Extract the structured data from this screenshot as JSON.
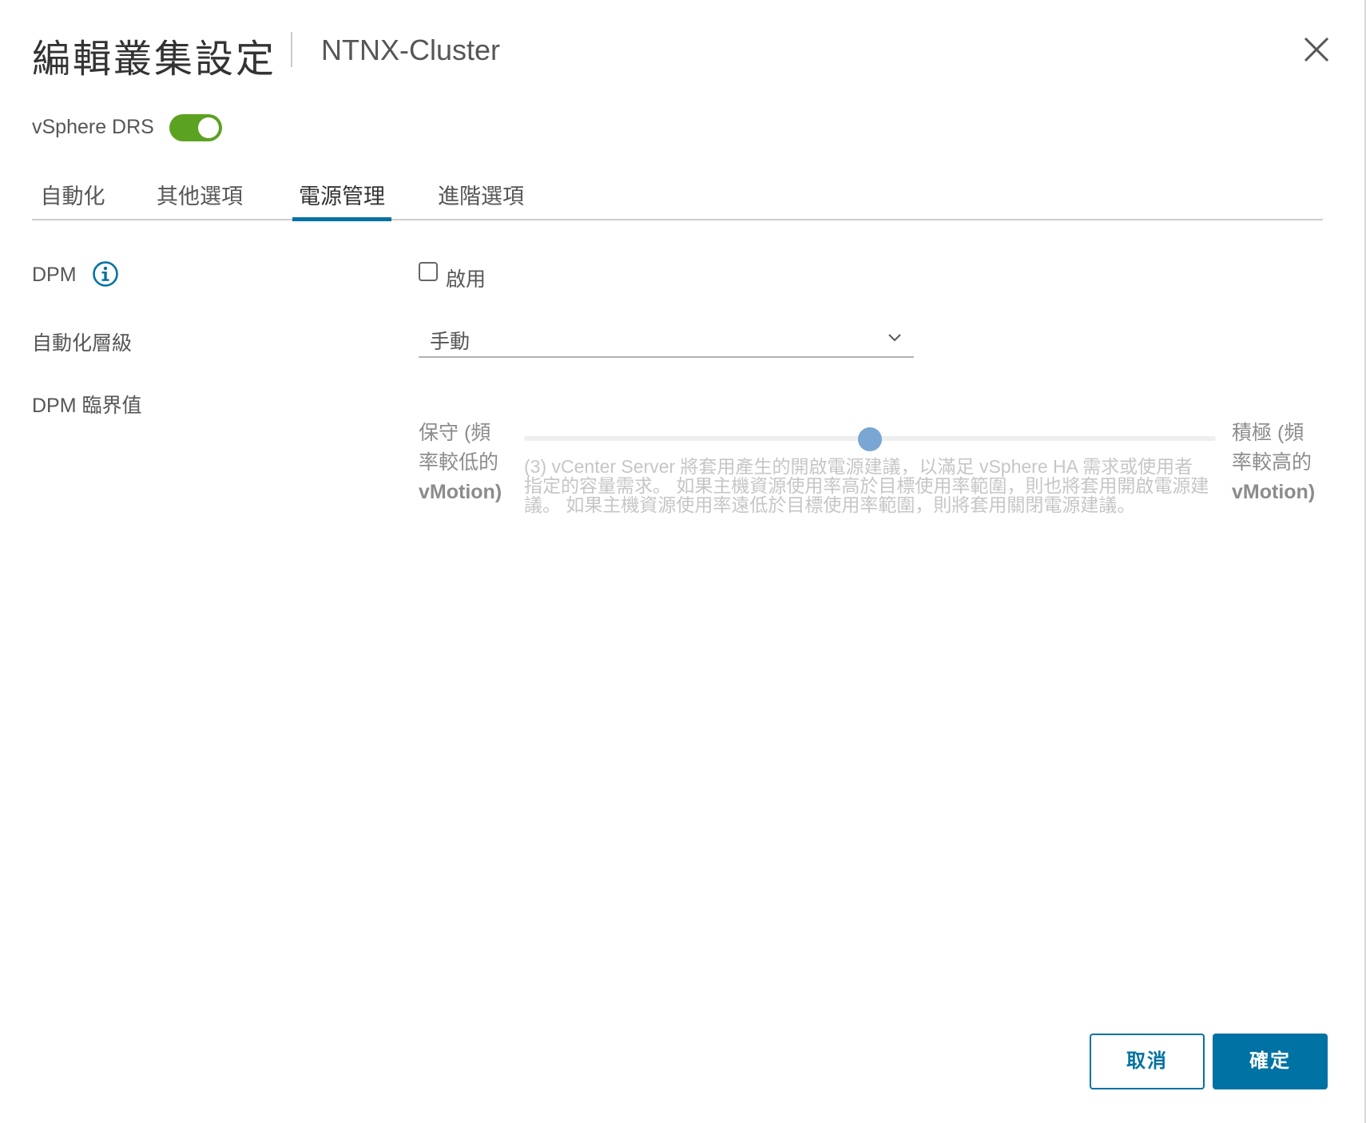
{
  "dialog": {
    "title": "編輯叢集設定",
    "subtitle": "NTNX-Cluster",
    "close_icon": "close-icon"
  },
  "drs": {
    "label": "vSphere DRS",
    "enabled": true,
    "toggle_color": "#5aa220"
  },
  "tabs": [
    {
      "label": "自動化",
      "active": false
    },
    {
      "label": "其他選項",
      "active": false
    },
    {
      "label": "電源管理",
      "active": true
    },
    {
      "label": "進階選項",
      "active": false
    }
  ],
  "form": {
    "dpm": {
      "label": "DPM",
      "info_icon": "info-icon",
      "checkbox_label": "啟用",
      "checked": false
    },
    "automation_level": {
      "label": "自動化層級",
      "value": "手動",
      "chevron_icon": "chevron-down-icon"
    },
    "dpm_threshold": {
      "label": "DPM 臨界值",
      "left_label_lines": [
        "保守 (頻",
        "率較低的",
        "vMotion)"
      ],
      "right_label_lines": [
        "積極 (頻",
        "率較高的",
        "vMotion)"
      ],
      "level": 3,
      "level_max": 5,
      "description": "(3) vCenter Server 將套用產生的開啟電源建議，以滿足 vSphere HA 需求或使用者指定的容量需求。 如果主機資源使用率高於目標使用率範圍，則也將套用開啟電源建議。 如果主機資源使用率遠低於目標使用率範圍，則將套用關閉電源建議。"
    }
  },
  "footer": {
    "cancel_label": "取消",
    "ok_label": "確定",
    "accent_color": "#0072a3"
  }
}
